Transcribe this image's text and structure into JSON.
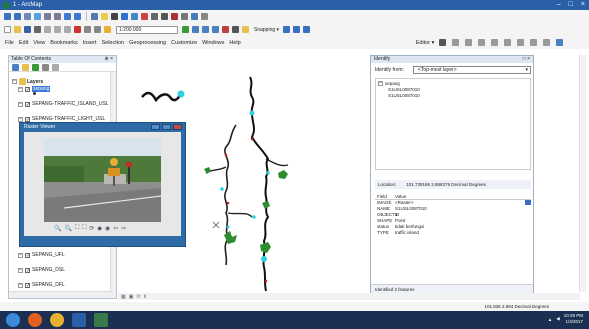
{
  "window": {
    "title": "1 - ArcMap",
    "controls": [
      "–",
      "□",
      "×"
    ]
  },
  "toolbar": {
    "scale": "1:200.000",
    "snapping_label": "Snapping ▾",
    "editor_label": "Editor ▾"
  },
  "menu": [
    "File",
    "Edit",
    "View",
    "Bookmarks",
    "Insert",
    "Selection",
    "Geoprocessing",
    "Customize",
    "Windows",
    "Help"
  ],
  "toc": {
    "title": "Table Of Contents",
    "pin": "⊕ ×",
    "layers_label": "Layers",
    "layers": [
      {
        "name": "sepang",
        "selected": true
      },
      {
        "name": "SEPANG-TRAFFIC_ISLAND_USL",
        "selected": false
      },
      {
        "name": "SEPANG-TRAFFIC_LIGHT_USL",
        "selected": false
      },
      {
        "name": "SEPANG_UFL",
        "selected": false
      },
      {
        "name": "SEPANG_DSL",
        "selected": false
      },
      {
        "name": "SEPANG_DFL",
        "selected": false
      }
    ]
  },
  "raster_viewer": {
    "title": "Raster Viewer",
    "tools": [
      "🔍",
      "🔍",
      "⛶",
      "⛶",
      "⟳",
      "◆",
      "◉",
      "⇦",
      "⇨"
    ]
  },
  "identify": {
    "title": "Identify",
    "close": "□ ×",
    "from_label": "Identify from:",
    "from_value": "<Top-most layer>",
    "tree_root": "sepang",
    "tree_children": [
      "S1USL0087010",
      "S1USL0087010"
    ],
    "location_label": "Location:",
    "location_value": "101.739186 2.888379 Decimal Degrees",
    "table_headers": {
      "field": "Field",
      "value": "Value"
    },
    "rows": [
      {
        "field": "IMAGE",
        "value": "<Raster>"
      },
      {
        "field": "NAME",
        "value": "S1USL0087010"
      },
      {
        "field": "OBJECTID",
        "value": "1"
      },
      {
        "field": "SHAPE",
        "value": "Point"
      },
      {
        "field": "status",
        "value": "tidak berfungsi"
      },
      {
        "field": "TYPE",
        "value": "traffic island"
      }
    ],
    "footer": "Identified 2 features"
  },
  "status": {
    "coords": "101.835 2.894 Decimal Degrees"
  },
  "taskbar": {
    "time": "10:28 PM",
    "date": "1/3/2017"
  }
}
